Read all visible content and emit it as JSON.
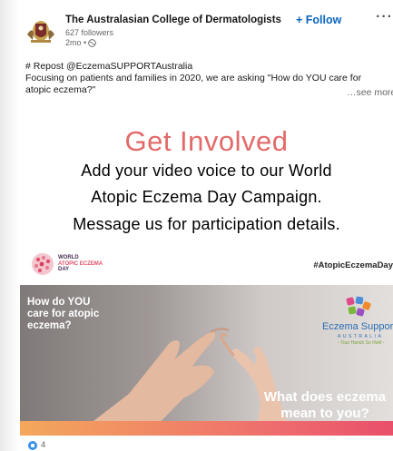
{
  "post": {
    "author": {
      "name": "The Australasian College of Dermatologists",
      "followers": "627 followers",
      "time": "2mo • "
    },
    "follow_label": "+ Follow",
    "more_label": "···",
    "text": {
      "line1": "# Repost @EczemaSUPPORTAustralia",
      "line2": "Focusing on patients and families in 2020, we are asking \"How do YOU care for",
      "line3": "atopic eczema?\"",
      "see_more": "…see more"
    },
    "image": {
      "headline": "Get Involved",
      "line1": "Add your video voice to our World",
      "line2": "Atopic Eczema Day Campaign.",
      "line3": "Message us for participation details.",
      "wad_logo_text": {
        "w1": "WORLD",
        "w2": "ATOPIC ECZEMA",
        "w3": "DAY"
      },
      "hashtag": "#AtopicEczemaDay",
      "question1": "How do YOU care for atopic eczema?",
      "question2": "What does eczema mean to you?",
      "es_name": "Eczema Support",
      "es_sub": "AUSTRALIA",
      "es_tag": "- Your Hands So Hold -"
    },
    "reactions": {
      "count": "4"
    }
  },
  "colors": {
    "follow_blue": "#0a66c2",
    "headline_red": "#e36a6a",
    "like_blue": "#378fe9"
  },
  "icons": [
    "college-crest-icon",
    "globe-icon",
    "more-icon",
    "like-icon",
    "wad-logo-icon",
    "eczema-support-logo-icon"
  ]
}
